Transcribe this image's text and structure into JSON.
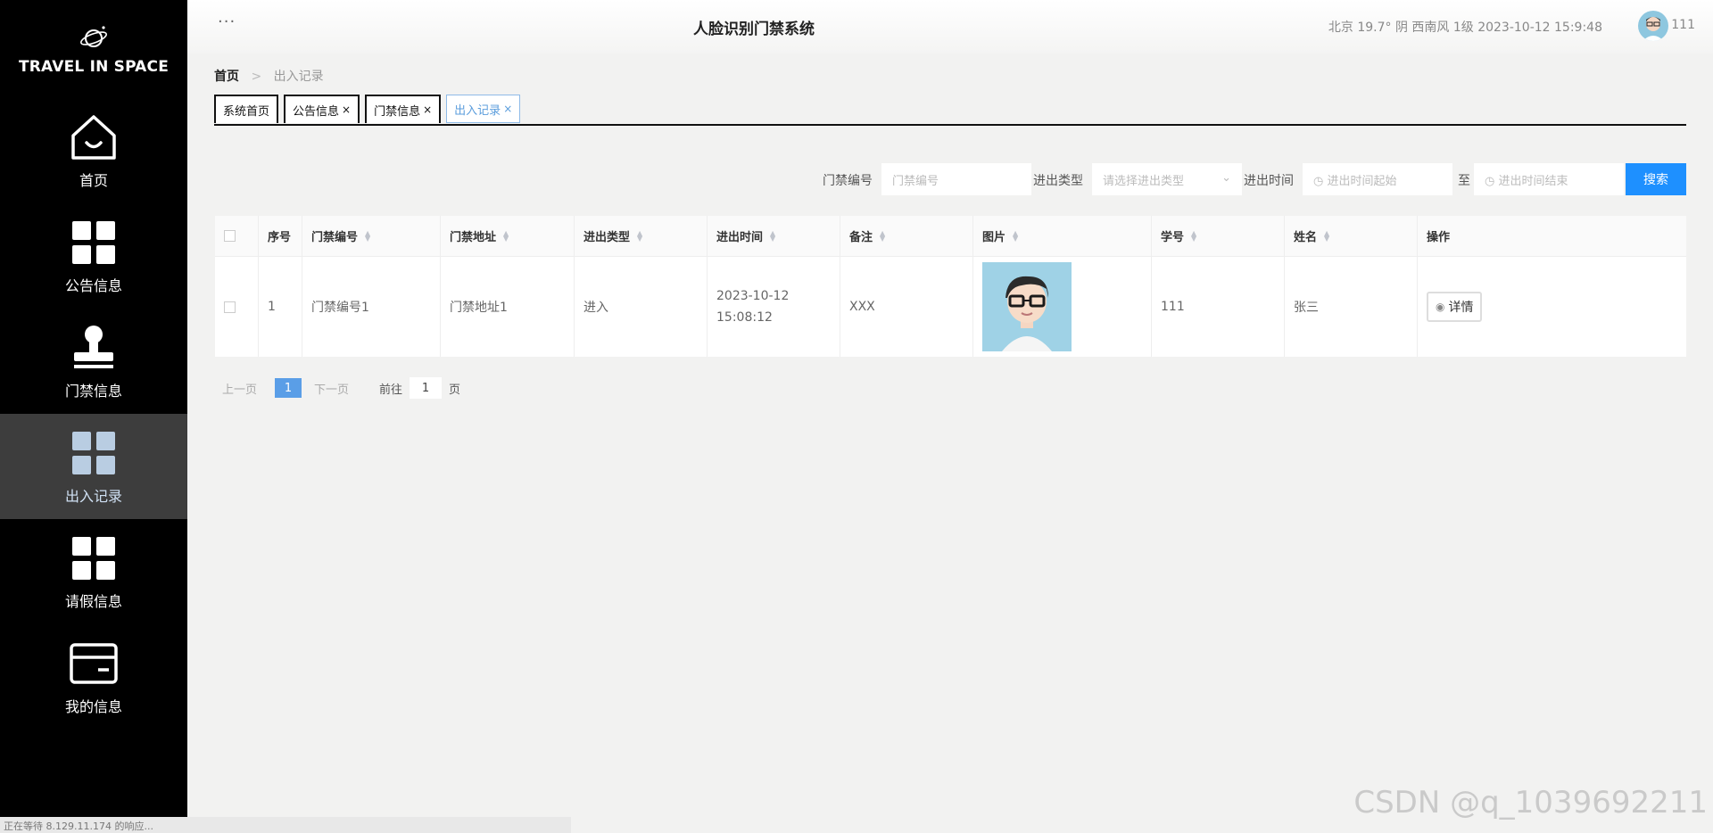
{
  "brand": {
    "logo_text": "TRAVEL IN SPACE"
  },
  "sidebar": {
    "items": [
      {
        "label": "首页",
        "icon": "home-icon",
        "active": false
      },
      {
        "label": "公告信息",
        "icon": "grid-icon",
        "active": false
      },
      {
        "label": "门禁信息",
        "icon": "stamp-icon",
        "active": false
      },
      {
        "label": "出入记录",
        "icon": "grid-icon",
        "active": true
      },
      {
        "label": "请假信息",
        "icon": "grid-icon",
        "active": false
      },
      {
        "label": "我的信息",
        "icon": "card-icon",
        "active": false
      }
    ]
  },
  "header": {
    "menu_dots": "···",
    "title": "人脸识别门禁系统",
    "weather": "北京  19.7°  阴  西南风  1级  2023-10-12 15:9:48",
    "username": "111"
  },
  "breadcrumb": {
    "home": "首页",
    "separator": ">",
    "current": "出入记录"
  },
  "tabs": [
    {
      "label": "系统首页",
      "closable": false
    },
    {
      "label": "公告信息",
      "closable": true
    },
    {
      "label": "门禁信息",
      "closable": true
    },
    {
      "label": "出入记录",
      "closable": true,
      "active": true
    }
  ],
  "tab_close_glyph": "×",
  "search": {
    "gate_no_label": "门禁编号",
    "gate_no_placeholder": "门禁编号",
    "type_label": "进出类型",
    "type_placeholder": "请选择进出类型",
    "time_label": "进出时间",
    "time_start_placeholder": "进出时间起始",
    "to_label": "至",
    "time_end_placeholder": "进出时间结束",
    "button": "搜索"
  },
  "table": {
    "columns": [
      "序号",
      "门禁编号",
      "门禁地址",
      "进出类型",
      "进出时间",
      "备注",
      "图片",
      "学号",
      "姓名",
      "操作"
    ],
    "rows": [
      {
        "index": "1",
        "gate_no": "门禁编号1",
        "gate_addr": "门禁地址1",
        "type": "进入",
        "time": "2023-10-12 15:08:12",
        "remark": "XXX",
        "student_no": "111",
        "name": "张三",
        "action": "详情"
      }
    ]
  },
  "pager": {
    "prev": "上一页",
    "current": "1",
    "next": "下一页",
    "goto_label": "前往",
    "goto_value": "1",
    "goto_suffix": "页"
  },
  "status_bar": "正在等待 8.129.11.174 的响应...",
  "watermark": "CSDN @q_1039692211",
  "colors": {
    "sidebar_bg": "#000000",
    "active_nav": "#3d3d3d",
    "accent": "#1e90ff",
    "page_bg": "#f2f2f1"
  }
}
